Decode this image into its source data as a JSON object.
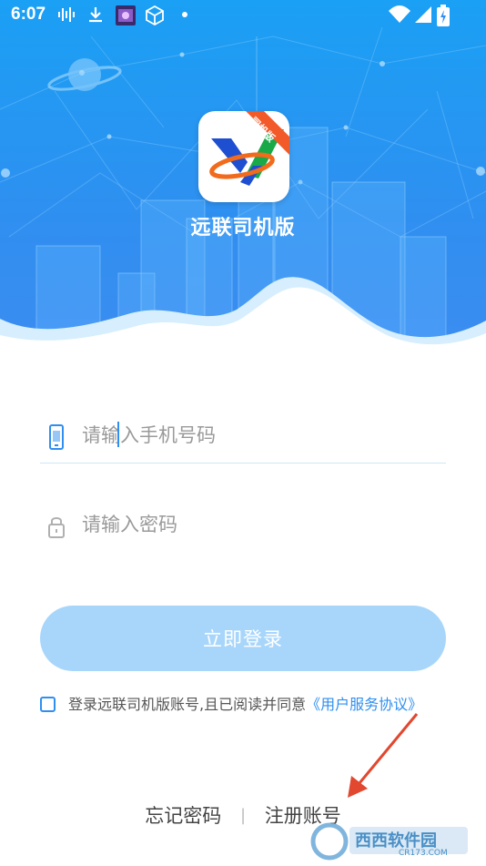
{
  "status_bar": {
    "time": "6:07"
  },
  "app": {
    "name": "远联司机版",
    "logo_badge": "司机版"
  },
  "form": {
    "phone_placeholder": "请输入手机号码",
    "password_placeholder": "请输入密码",
    "login_label": "立即登录"
  },
  "agreement": {
    "text": "登录远联司机版账号,且已阅读并同意",
    "link": "《用户服务协议》",
    "checked": false
  },
  "links": {
    "forgot": "忘记密码",
    "separator": "|",
    "register": "注册账号"
  },
  "watermark": {
    "text": "西西软件园",
    "sub": "CR173.COM"
  },
  "colors": {
    "primary": "#2f8ff0",
    "button_disabled": "#a8d6fb",
    "arrow": "#e2472f"
  },
  "icons": {
    "phone": "phone-icon",
    "lock": "lock-icon",
    "wifi": "wifi-icon",
    "signal": "signal-icon",
    "battery": "battery-icon"
  }
}
